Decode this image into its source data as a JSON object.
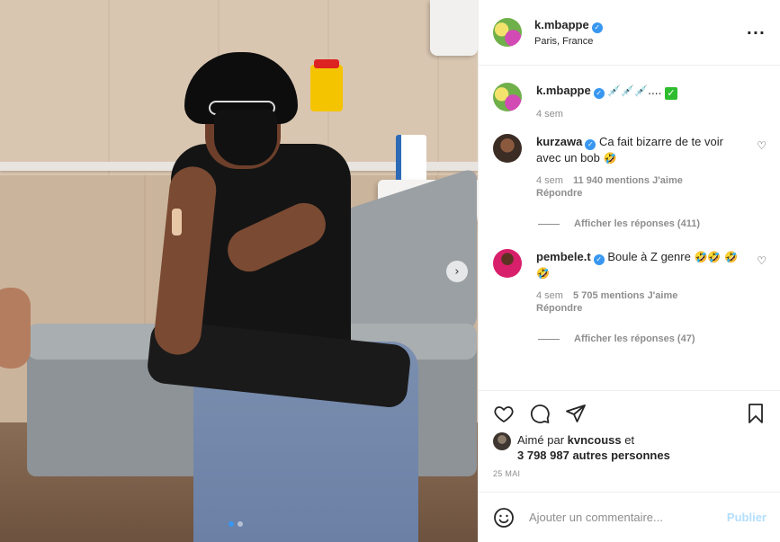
{
  "post": {
    "author": "k.mbappe",
    "location": "Paris, France",
    "more_icon": "more-horizontal-icon",
    "image_alt": "photo",
    "carousel": {
      "current": 1,
      "total": 2
    }
  },
  "caption": {
    "username": "k.mbappe",
    "emojis": "💉💉💉....",
    "check": "✓",
    "time": "4 sem"
  },
  "comments": [
    {
      "username": "kurzawa",
      "text": "Ca fait bizarre de te voir avec un bob",
      "emoji": "🤣",
      "time": "4 sem",
      "likes": "11 940 mentions J'aime",
      "reply": "Répondre",
      "view_replies": "Afficher les réponses (411)"
    },
    {
      "username": "pembele.t",
      "text": "Boule à Z genre",
      "emoji_tail": "🤣🤣 🤣🤣",
      "time": "4 sem",
      "likes": "5 705 mentions J'aime",
      "reply": "Répondre",
      "view_replies": "Afficher les réponses (47)"
    }
  ],
  "liked_by": {
    "prefix": "Aimé par",
    "user": "kvncouss",
    "and": "et",
    "others": "3 798 987 autres personnes"
  },
  "date": "25 MAI",
  "add_comment": {
    "placeholder": "Ajouter un commentaire...",
    "post_label": "Publier"
  },
  "colors": {
    "link": "#3897f0",
    "muted": "#8e8e8e",
    "text": "#262626",
    "post_disabled": "#b2dffc"
  }
}
